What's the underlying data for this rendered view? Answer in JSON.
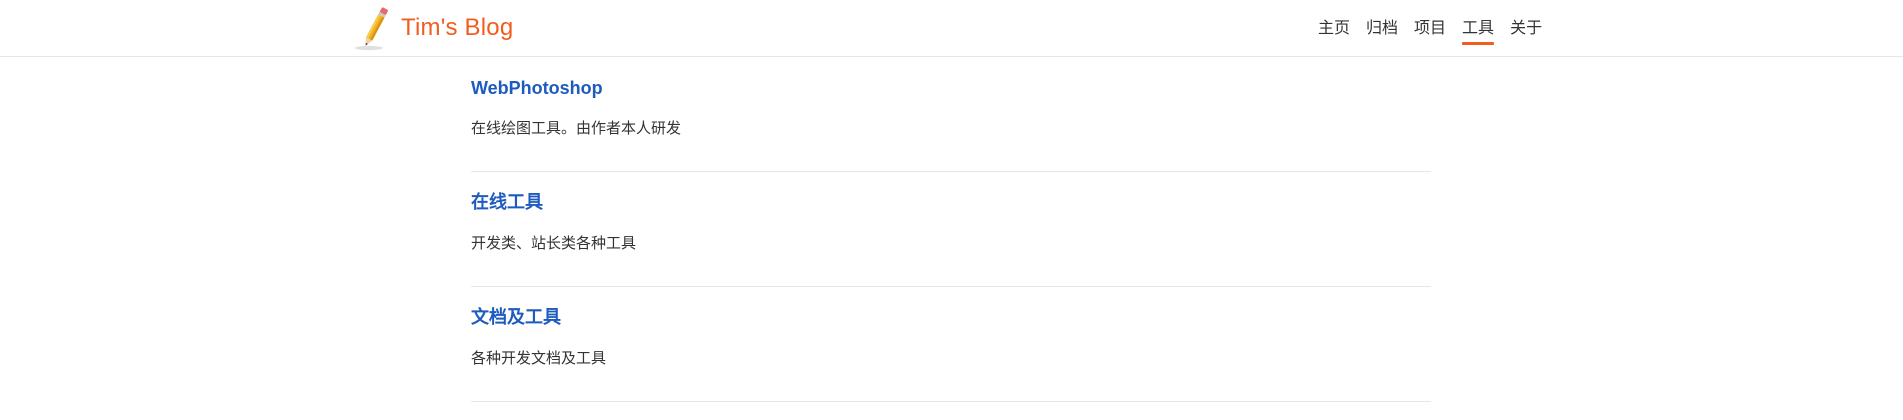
{
  "header": {
    "site_title": "Tim's Blog",
    "logo_icon": "pencil-icon",
    "accent_color": "#f25d1f"
  },
  "nav": {
    "items": [
      {
        "label": "主页",
        "active": false
      },
      {
        "label": "归档",
        "active": false
      },
      {
        "label": "项目",
        "active": false
      },
      {
        "label": "工具",
        "active": true
      },
      {
        "label": "关于",
        "active": false
      }
    ]
  },
  "tools": [
    {
      "title": "WebPhotoshop",
      "description": "在线绘图工具。由作者本人研发"
    },
    {
      "title": "在线工具",
      "description": "开发类、站长类各种工具"
    },
    {
      "title": "文档及工具",
      "description": "各种开发文档及工具"
    }
  ],
  "colors": {
    "link": "#1e5bbf",
    "text": "#333333",
    "divider": "#e6e6e6"
  }
}
